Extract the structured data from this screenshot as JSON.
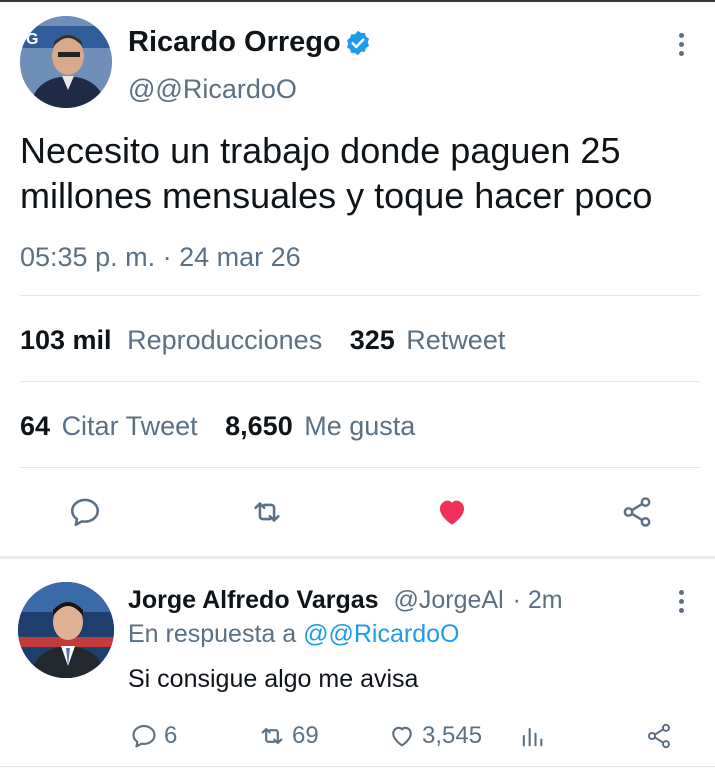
{
  "tweet": {
    "author_name": "Ricardo Orrego",
    "author_handle": "@@RicardoO",
    "text": "Necesito un trabajo donde paguen 25 millones mensuales y toque hacer poco",
    "timestamp": "05:35 p. m. · 24 mar 26",
    "stats": {
      "views_num": "103 mil",
      "views_label": "Reproducciones",
      "retweets_num": "325",
      "retweets_label": "Retweet",
      "quotes_num": "64",
      "quotes_label": "Citar Tweet",
      "likes_num": "8,650",
      "likes_label": "Me gusta"
    },
    "actions": [
      "reply-icon",
      "retweet-icon",
      "heart-icon",
      "share-icon"
    ],
    "liked": true
  },
  "reply": {
    "author_name": "Jorge Alfredo Vargas",
    "author_handle": "@JorgeAl",
    "time": "· 2m",
    "replying_prefix": "En respuesta a",
    "replying_to": "@@RicardoO",
    "text": "Si consigue algo me avisa",
    "counts": {
      "replies": "6",
      "retweets": "69",
      "likes": "3,545"
    }
  },
  "colors": {
    "accent": "#1d9bf0",
    "like": "#f91880",
    "muted": "#5b7083"
  }
}
